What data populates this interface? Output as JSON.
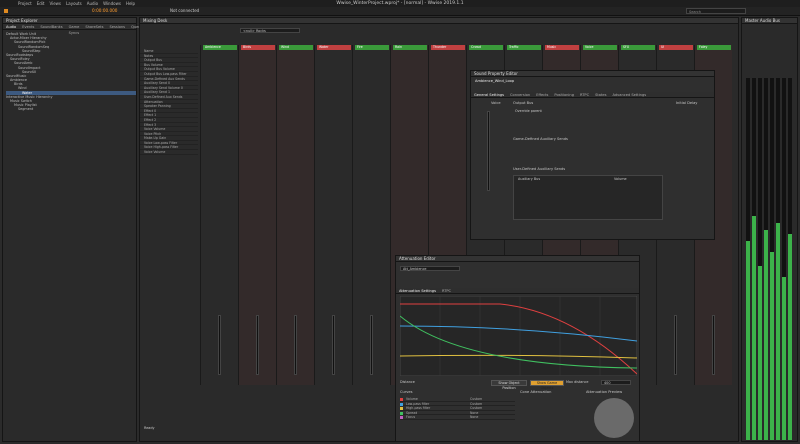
{
  "menu": [
    "Project",
    "Edit",
    "Views",
    "Layouts",
    "Audio",
    "Windows",
    "Help"
  ],
  "window_title": "Wwise_WinterProject.wproj* - [normal] - Wwise 2019.1.1",
  "toolbar": {
    "time": "0:00:00.000",
    "session": "Wwise Mixing Desk",
    "audio_output": "Not connected",
    "search_placeholder": "Search"
  },
  "explorer": {
    "title": "Project Explorer",
    "tabs": [
      "Audio",
      "Events",
      "SoundBanks",
      "Game Syncs",
      "ShareSets",
      "Sessions",
      "Queries"
    ],
    "items": [
      "Default Work Unit",
      "Actor-Mixer Hierarchy",
      "SoundRandomPick",
      "SoundRandomSeq",
      "SoundStep",
      "SoundFootsteps",
      "SoundFoley",
      "SoundAmb",
      "SoundImpact",
      "SoundUI",
      "SoundMusic",
      "Ambience",
      "Birds",
      "Wind",
      "Water",
      "Interactive Music Hierarchy",
      "Music Switch",
      "Music Playlist",
      "Segment"
    ],
    "selected_index": 14
  },
  "mixer": {
    "title": "Mixing Desk",
    "name_field": "<null> Rocks",
    "row_labels": [
      "Name",
      "Notes",
      "Output Bus",
      "Bus Volume",
      "Output Bus Volume",
      "Output Bus Low-pass Filter",
      "Game-Defined Aux Sends",
      "Auxiliary Send 0",
      "Auxiliary Send Volume 0",
      "Auxiliary Send 1",
      "User-Defined Aux Sends",
      "Attenuation",
      "Speaker Panning",
      "Effect 0",
      "Effect 1",
      "Effect 2",
      "Effect 3",
      "Voice Volume",
      "Voice Pitch",
      "Make-Up Gain",
      "Voice Low-pass Filter",
      "Voice High-pass Filter",
      "Voice Volume"
    ],
    "strips": [
      "Ambience",
      "Birds",
      "Wind",
      "Water",
      "Fire",
      "Rain",
      "Thunder",
      "Crowd",
      "Traffic",
      "Music",
      "Voice",
      "SFX",
      "UI",
      "Foley"
    ],
    "strip_colors": [
      "#3a9a3a",
      "#c04040",
      "#3a9a3a",
      "#c04040",
      "#3a9a3a",
      "#3a9a3a",
      "#c04040",
      "#3a9a3a",
      "#3a9a3a",
      "#c04040",
      "#3a9a3a",
      "#3a9a3a",
      "#c04040",
      "#3a9a3a"
    ],
    "volume_label": "Voice Volume",
    "status": "Ready"
  },
  "sound_props": {
    "title": "Sound Property Editor",
    "name": "Ambience_Wind_Loop",
    "tabs": [
      "General Settings",
      "Conversion",
      "Effects",
      "Positioning",
      "RTPC",
      "States",
      "Advanced Settings"
    ],
    "output_bus": "Output Bus",
    "override_parent": "Override parent",
    "aux_sends": "Game-Defined Auxiliary Sends",
    "user_aux": "User-Defined Auxiliary Sends",
    "aux_bus_col": "Auxiliary Bus",
    "volume_col": "Volume",
    "initial_delay": "Initial Delay",
    "voice": "Voice"
  },
  "attenuation": {
    "title": "Attenuation Editor",
    "name": "Att_Ambience",
    "tabs": [
      "Attenuation Settings",
      "RTPC"
    ],
    "curve_labels": [
      "Output Bus Volume",
      "Auxiliary Send",
      "Low-pass Filter",
      "High-pass Filter",
      "Spread",
      "Focus"
    ],
    "x_axis_label": "Distance",
    "max_distance_label": "Max distance",
    "max_distance": "400",
    "buttons": [
      "Show Object Position",
      "Show Game Objects"
    ],
    "curves_title": "Curves",
    "curve_list": [
      {
        "name": "Volume",
        "value": "Custom",
        "color": "#e04040"
      },
      {
        "name": "Low-pass filter",
        "value": "Custom",
        "color": "#40a0e0"
      },
      {
        "name": "High-pass filter",
        "value": "Custom",
        "color": "#e0c040"
      },
      {
        "name": "Spread",
        "value": "None",
        "color": "#40c060"
      },
      {
        "name": "Focus",
        "value": "None",
        "color": "#c060c0"
      }
    ],
    "cone_label": "Cone Attenuation",
    "preview_label": "Attenuation Preview"
  },
  "meter": {
    "title": "Master Audio Bus",
    "levels": [
      0.55,
      0.62,
      0.48,
      0.58,
      0.52,
      0.6,
      0.45,
      0.57
    ]
  }
}
